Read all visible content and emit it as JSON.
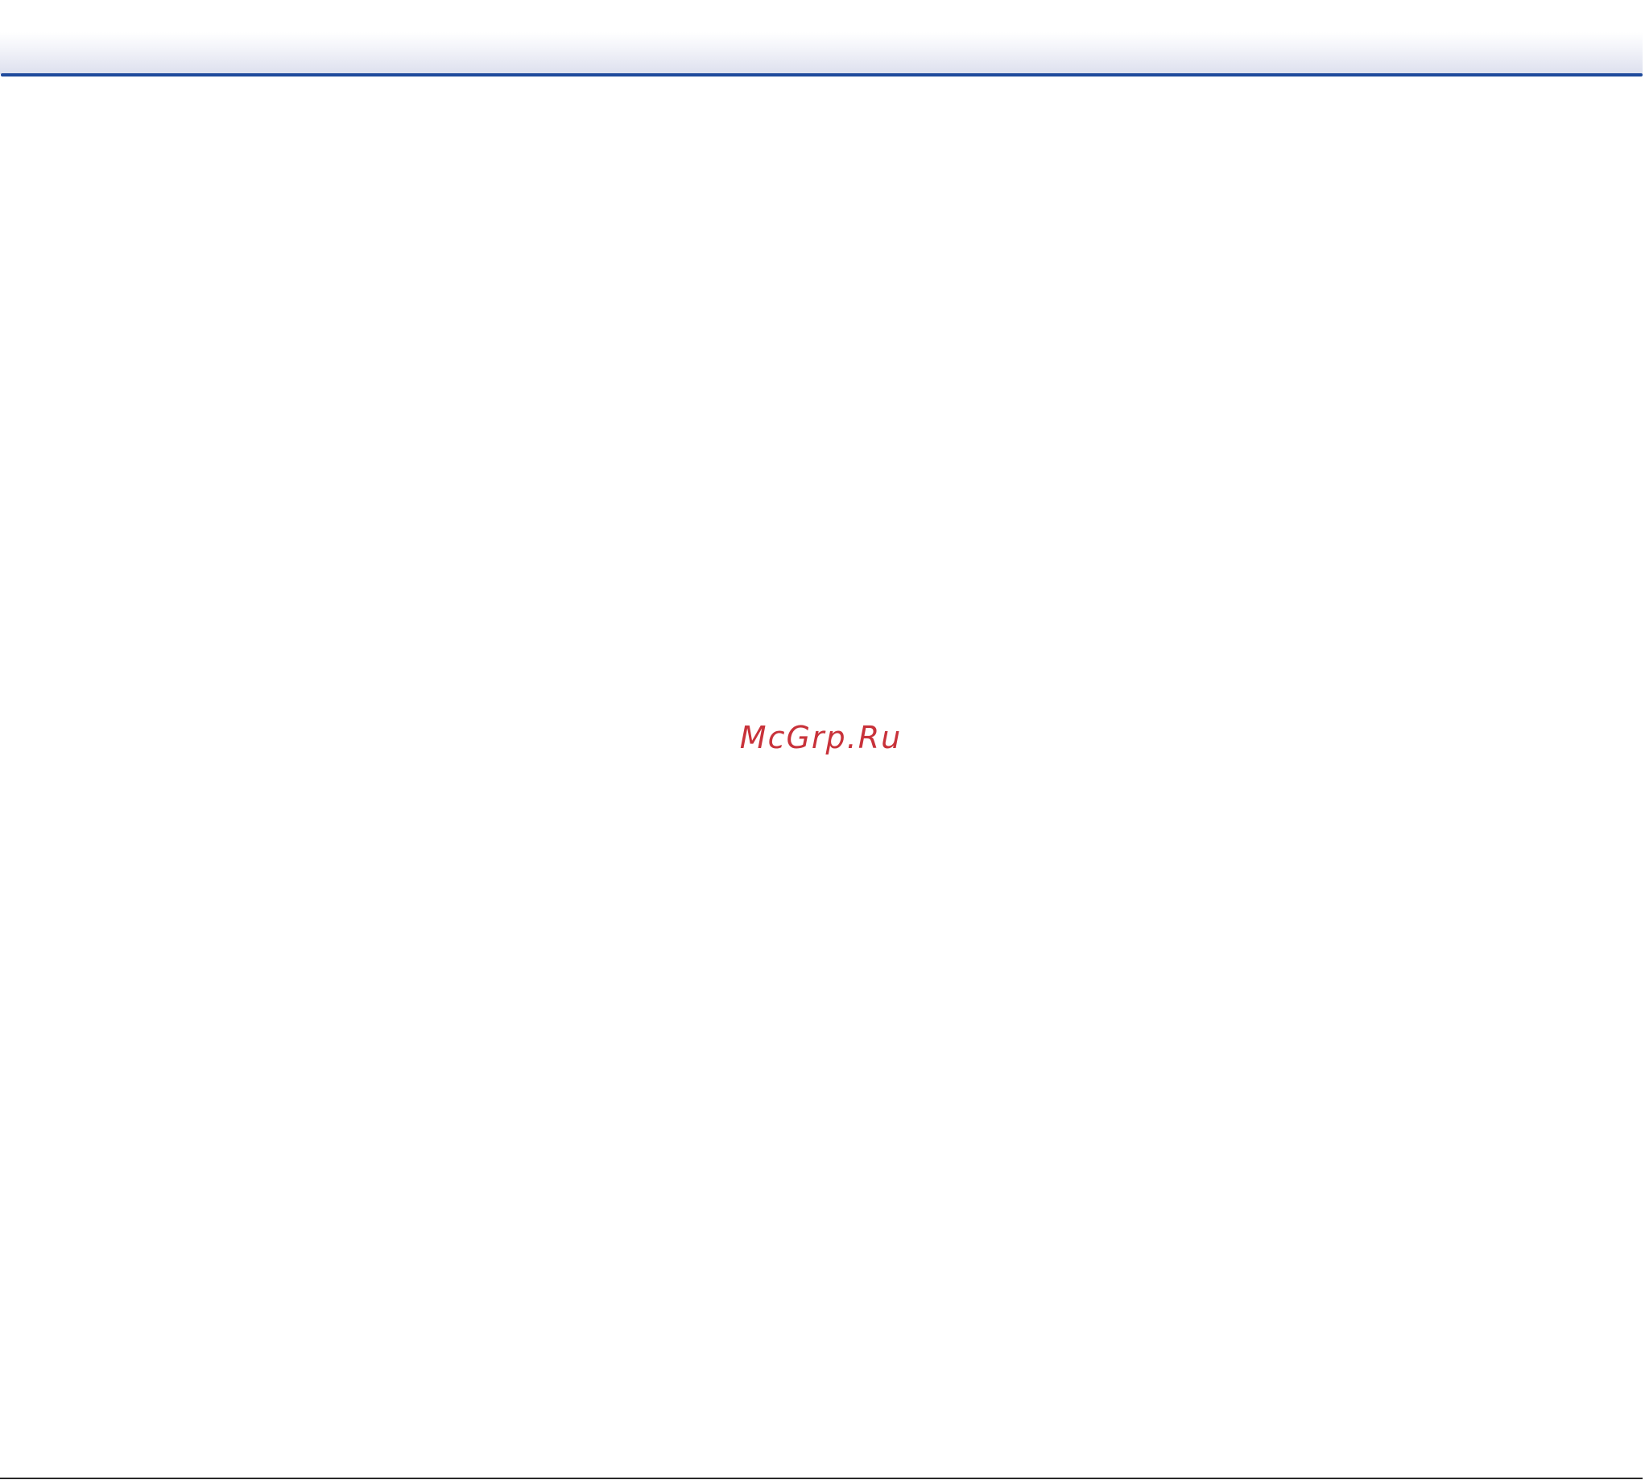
{
  "document": {
    "watermark": "McGrp.Ru"
  },
  "colors": {
    "header_rule": "#1e4a9c",
    "header_gradient_end": "#dde0ee",
    "watermark_text": "#c8323a",
    "footer_rule": "#2a2a2a"
  }
}
